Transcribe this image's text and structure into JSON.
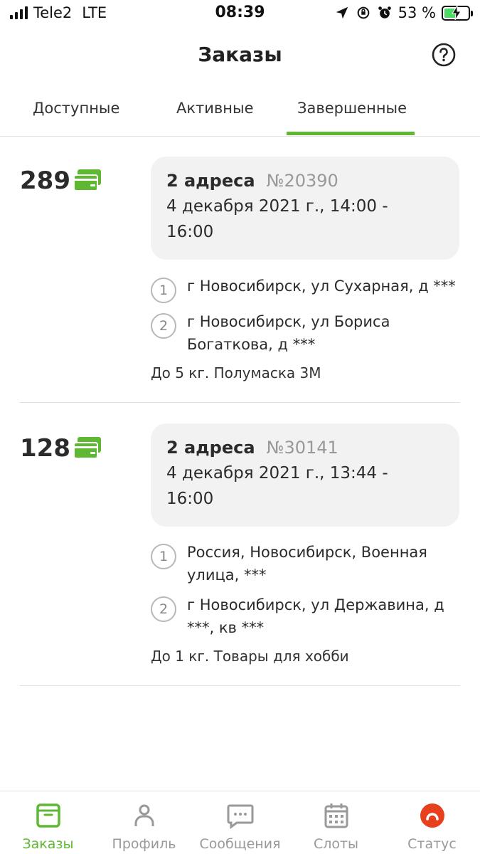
{
  "status_bar": {
    "carrier": "Tele2",
    "network": "LTE",
    "time": "08:39",
    "battery_percent": "53 %",
    "battery_level": 0.53
  },
  "header": {
    "title": "Заказы"
  },
  "tabs": [
    {
      "label": "Доступные",
      "active": false
    },
    {
      "label": "Активные",
      "active": false
    },
    {
      "label": "Завершенные",
      "active": true
    }
  ],
  "orders": [
    {
      "price": "289",
      "address_count": "2 адреса",
      "order_number": "№20390",
      "date": "4 декабря 2021 г., 14:00 - 16:00",
      "addresses": [
        {
          "num": "1",
          "text": "г Новосибирск, ул Сухарная, д ***"
        },
        {
          "num": "2",
          "text": "г Новосибирск, ул Бориса Богаткова, д ***"
        }
      ],
      "description": "До 5 кг. Полумаска 3М"
    },
    {
      "price": "128",
      "address_count": "2 адреса",
      "order_number": "№30141",
      "date": "4 декабря 2021 г., 13:44 - 16:00",
      "addresses": [
        {
          "num": "1",
          "text": "Россия, Новосибирск, Военная улица, ***"
        },
        {
          "num": "2",
          "text": "г Новосибирск, ул Державина, д ***, кв ***"
        }
      ],
      "description": "До 1 кг. Товары для хобби"
    }
  ],
  "bottom_nav": [
    {
      "label": "Заказы",
      "icon": "box-icon",
      "active": true
    },
    {
      "label": "Профиль",
      "icon": "person-icon",
      "active": false
    },
    {
      "label": "Сообщения",
      "icon": "chat-icon",
      "active": false
    },
    {
      "label": "Слоты",
      "icon": "calendar-icon",
      "active": false
    },
    {
      "label": "Статус",
      "icon": "status-icon",
      "active": false
    }
  ],
  "colors": {
    "accent": "#5fb832",
    "card_bg": "#f2f2f2",
    "status_red": "#e8401f"
  }
}
